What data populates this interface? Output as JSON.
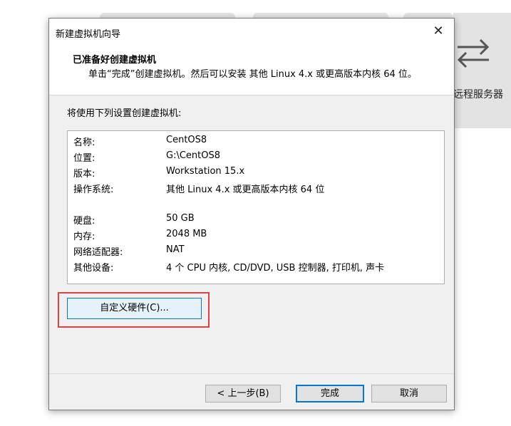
{
  "dialog": {
    "window_title": "新建虚拟机向导",
    "close_glyph": "✕",
    "header_title": "已准备好创建虚拟机",
    "header_desc": "单击“完成”创建虚拟机。然后可以安装 其他 Linux 4.x 或更高版本内核 64 位。",
    "intro": "将使用下列设置创建虚拟机:",
    "summary": [
      {
        "key": "名称:",
        "value": "CentOS8"
      },
      {
        "key": "位置:",
        "value": "G:\\CentOS8"
      },
      {
        "key": "版本:",
        "value": "Workstation 15.x"
      },
      {
        "key": "操作系统:",
        "value": "其他 Linux 4.x 或更高版本内核 64 位"
      },
      {
        "key": "硬盘:",
        "value": "50 GB"
      },
      {
        "key": "内存:",
        "value": "2048 MB"
      },
      {
        "key": "网络适配器:",
        "value": "NAT"
      },
      {
        "key": "其他设备:",
        "value": "4 个 CPU 内核, CD/DVD, USB 控制器, 打印机, 声卡"
      }
    ],
    "customize_button": "自定义硬件(C)...",
    "back_button": "< 上一步(B)",
    "finish_button": "完成",
    "cancel_button": "取消"
  },
  "background": {
    "remote_label": "远程服务器",
    "icon": "swap-arrows-icon"
  },
  "colors": {
    "highlight_border": "#e0423d",
    "focus_blue": "#0078d7",
    "dialog_bg": "#f0f0f0"
  }
}
